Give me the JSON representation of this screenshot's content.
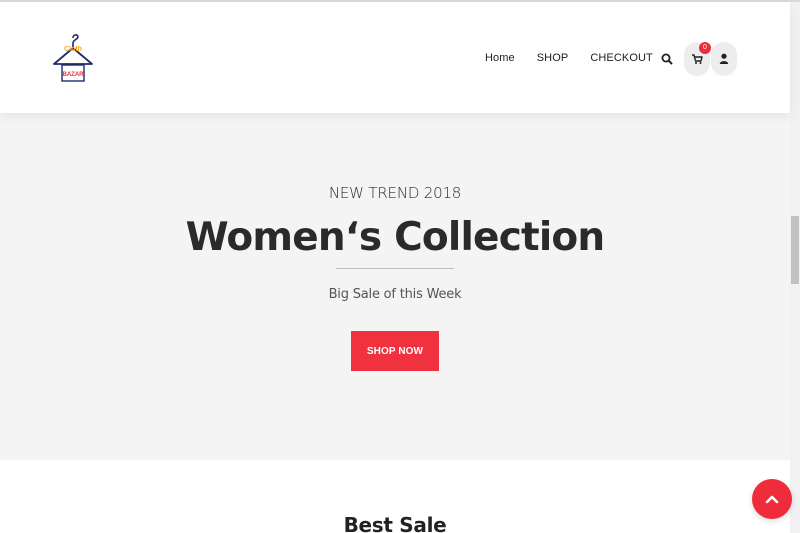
{
  "brand": {
    "logo_top": "Cloth",
    "logo_bottom": "BAZAR"
  },
  "nav": {
    "items": [
      {
        "label": "Home"
      },
      {
        "label": "SHOP"
      },
      {
        "label": "CHECKOUT"
      }
    ]
  },
  "header_actions": {
    "search_icon": "search-icon",
    "cart_icon": "cart-icon",
    "cart_count": "0",
    "user_icon": "user-icon"
  },
  "hero": {
    "kicker": "NEW TREND 2018",
    "title": "Women‘s Collection",
    "subtitle": "Big Sale of this Week",
    "button_label": "SHOP NOW"
  },
  "sections": {
    "best_sale_title": "Best Sale"
  },
  "colors": {
    "accent": "#f0313e",
    "hero_bg": "#f4f4f4",
    "header_bg": "#ffffff"
  }
}
